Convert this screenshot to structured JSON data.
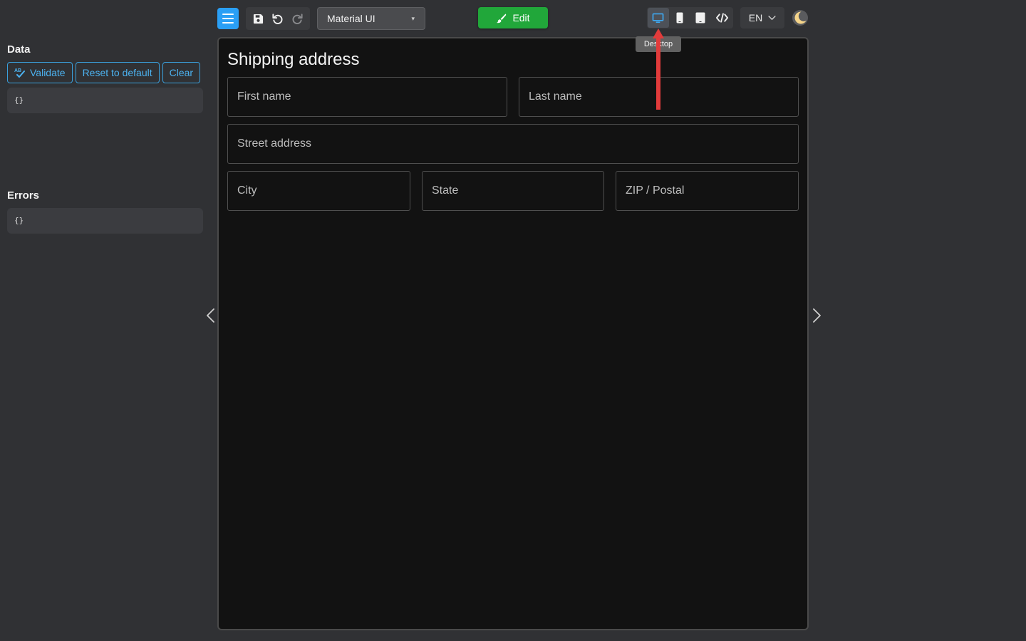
{
  "toolbar": {
    "theme_selected": "Material UI",
    "edit_label": "Edit",
    "language": "EN",
    "tooltip": "Desktop",
    "accent_color": "#2a9ff5",
    "edit_color": "#21a73a"
  },
  "sidebar": {
    "data_title": "Data",
    "validate_label": "Validate",
    "reset_label": "Reset to default",
    "clear_label": "Clear",
    "data_json": "{}",
    "errors_title": "Errors",
    "errors_json": "{}"
  },
  "form": {
    "title": "Shipping address",
    "fields": {
      "first_name": "First name",
      "last_name": "Last name",
      "street": "Street address",
      "city": "City",
      "state": "State",
      "zip": "ZIP / Postal"
    }
  },
  "icons": {
    "menu": "hamburger-menu-icon",
    "save": "save-icon",
    "undo": "undo-icon",
    "redo": "redo-icon",
    "desktop": "desktop-icon",
    "mobile": "mobile-icon",
    "tablet": "tablet-icon",
    "code": "code-icon",
    "dark_mode": "moon-icon"
  }
}
